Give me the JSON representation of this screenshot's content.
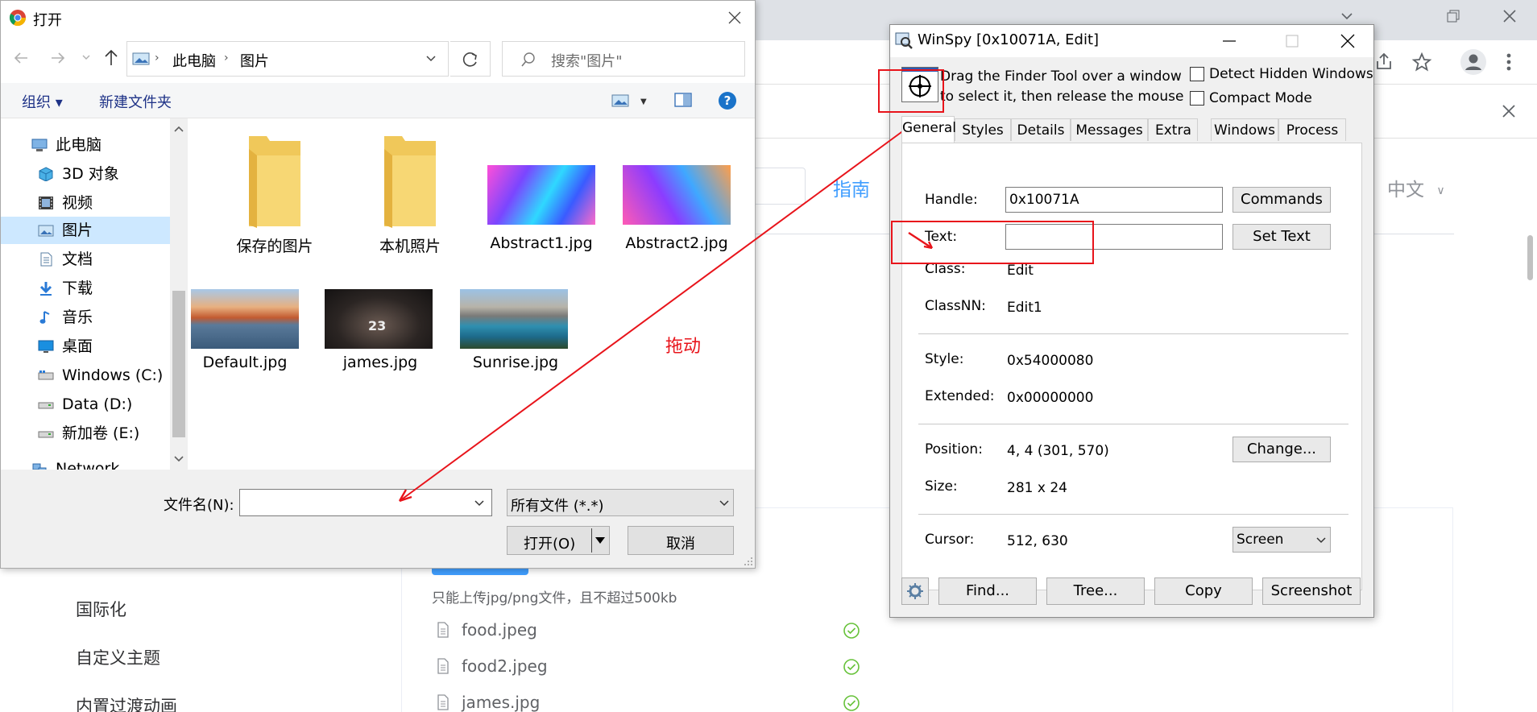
{
  "open_dialog": {
    "title": "打开",
    "breadcrumb": [
      "此电脑",
      "图片"
    ],
    "search_placeholder": "搜索\"图片\"",
    "toolbar": {
      "organize": "组织 ▾",
      "new_folder": "新建文件夹"
    },
    "nav_items": [
      {
        "label": "此电脑",
        "icon": "pc-icon"
      },
      {
        "label": "3D 对象",
        "icon": "cube-icon"
      },
      {
        "label": "视频",
        "icon": "video-icon"
      },
      {
        "label": "图片",
        "icon": "pictures-icon"
      },
      {
        "label": "文档",
        "icon": "document-icon"
      },
      {
        "label": "下载",
        "icon": "download-icon"
      },
      {
        "label": "音乐",
        "icon": "music-icon"
      },
      {
        "label": "桌面",
        "icon": "desktop-icon"
      },
      {
        "label": "Windows (C:)",
        "icon": "drive-icon"
      },
      {
        "label": "Data (D:)",
        "icon": "drive-icon"
      },
      {
        "label": "新加卷 (E:)",
        "icon": "drive-icon"
      },
      {
        "label": "Network",
        "icon": "network-icon"
      }
    ],
    "files": [
      {
        "name": "保存的图片",
        "kind": "folder"
      },
      {
        "name": "本机照片",
        "kind": "folder"
      },
      {
        "name": "Abstract1.jpg",
        "kind": "image"
      },
      {
        "name": "Abstract2.jpg",
        "kind": "image"
      },
      {
        "name": "Default.jpg",
        "kind": "image"
      },
      {
        "name": "james.jpg",
        "kind": "image"
      },
      {
        "name": "Sunrise.jpg",
        "kind": "image"
      }
    ],
    "filename_label": "文件名(N):",
    "filename_value": "",
    "filter_value": "所有文件 (*.*)",
    "open_button": "打开(O)",
    "cancel_button": "取消"
  },
  "annotation_text": "拖动",
  "winspy": {
    "title": "WinSpy [0x10071A, Edit]",
    "finder_text_1": "Drag the Finder Tool over a window",
    "finder_text_2": "to select it, then release the mouse",
    "detect_hidden": "Detect Hidden Windows",
    "compact_mode": "Compact Mode",
    "tabs": [
      "General",
      "Styles",
      "Details",
      "Messages",
      "Extra",
      "Windows",
      "Process"
    ],
    "handle_label": "Handle:",
    "handle_value": "0x10071A",
    "text_label": "Text:",
    "text_value": "",
    "class_label": "Class:",
    "class_value": "Edit",
    "classnn_label": "ClassNN:",
    "classnn_value": "Edit1",
    "style_label": "Style:",
    "style_value": "0x54000080",
    "extended_label": "Extended:",
    "extended_value": "0x00000000",
    "position_label": "Position:",
    "position_value": "4, 4 (301, 570)",
    "size_label": "Size:",
    "size_value": "281 x 24",
    "cursor_label": "Cursor:",
    "cursor_value": "512, 630",
    "cursor_mode": "Screen",
    "buttons": {
      "commands": "Commands",
      "set_text": "Set Text",
      "change": "Change...",
      "find": "Find...",
      "tree": "Tree...",
      "copy": "Copy",
      "screenshot": "Screenshot"
    }
  },
  "background": {
    "nav_link": "指南",
    "lang": "中文",
    "upload_hint": "只能上传jpg/png文件，且不超过500kb",
    "menu": [
      "国际化",
      "自定义主题",
      "内置过渡动画"
    ],
    "files": [
      "food.jpeg",
      "food2.jpeg",
      "james.jpg"
    ]
  },
  "colors": {
    "accent": "#0078d7",
    "annotation": "#e8141b",
    "success": "#67c23a",
    "link": "#409eff"
  }
}
